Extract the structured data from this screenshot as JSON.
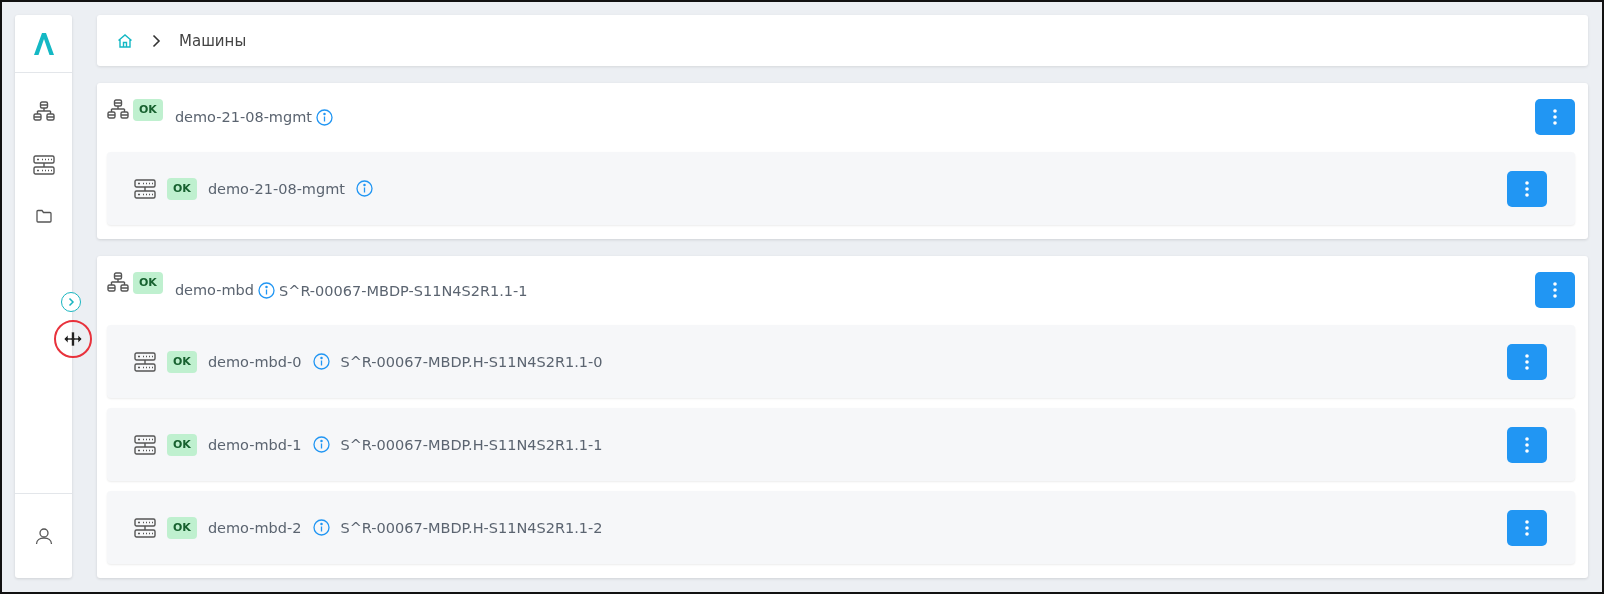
{
  "sidebar": {
    "items": [
      {
        "kind": "cluster",
        "selected": false
      },
      {
        "kind": "server",
        "selected": false
      },
      {
        "kind": "folder",
        "selected": false
      }
    ],
    "collapsed": true
  },
  "breadcrumb": {
    "current": "Машины"
  },
  "groups": [
    {
      "name": "demo-21-08-mgmt",
      "status": "OK",
      "machines": [
        {
          "name": "demo-21-08-mgmt",
          "status": "OK"
        }
      ]
    },
    {
      "name": "demo-mbd",
      "status": "OK",
      "serial": "S^R-00067-MBDP-S11N4S2R1.1-1",
      "machines": [
        {
          "name": "demo-mbd-0",
          "status": "OK",
          "serial": "S^R-00067-MBDP.H-S11N4S2R1.1-0"
        },
        {
          "name": "demo-mbd-1",
          "status": "OK",
          "serial": "S^R-00067-MBDP.H-S11N4S2R1.1-1"
        },
        {
          "name": "demo-mbd-2",
          "status": "OK",
          "serial": "S^R-00067-MBDP.H-S11N4S2R1.1-2"
        }
      ]
    }
  ]
}
